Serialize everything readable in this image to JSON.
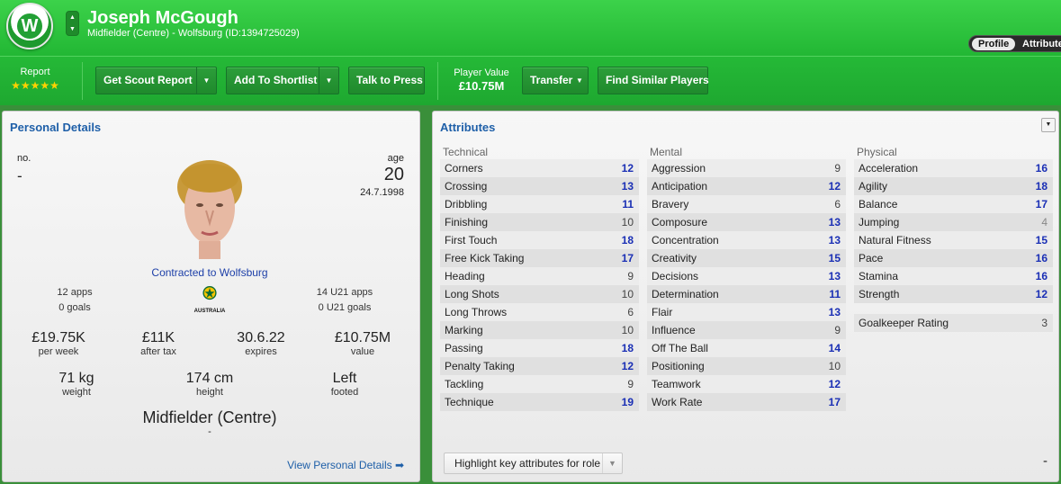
{
  "header": {
    "club_initial": "W",
    "player_name": "Joseph McGough",
    "subtitle": "Midfielder (Centre) - Wolfsburg (ID:1394725029)",
    "tabs": {
      "profile": "Profile",
      "attributes": "Attributes"
    },
    "nav_up": "▲",
    "nav_down": "▼"
  },
  "toolbar": {
    "report_label": "Report",
    "report_stars": "★★★★★",
    "report_rating": 4.5,
    "get_scout_report": "Get Scout Report",
    "add_to_shortlist": "Add To Shortlist",
    "talk_to_press": "Talk to Press",
    "player_value_label": "Player Value",
    "player_value": "£10.75M",
    "transfer": "Transfer",
    "find_similar": "Find Similar Players",
    "dropdown_glyph": "▼"
  },
  "personal": {
    "title": "Personal Details",
    "no_label": "no.",
    "no_value": "-",
    "age_label": "age",
    "age_value": "20",
    "dob": "24.7.1998",
    "contract": "Contracted to Wolfsburg",
    "apps": "12 apps",
    "goals": "0 goals",
    "u21_apps": "14 U21 apps",
    "u21_goals": "0 U21 goals",
    "nation": "AUSTRALIA",
    "wage": "£19.75K",
    "wage_label": "per week",
    "after_tax": "£11K",
    "after_tax_label": "after tax",
    "expires": "30.6.22",
    "expires_label": "expires",
    "value": "£10.75M",
    "value_label": "value",
    "weight": "71 kg",
    "weight_label": "weight",
    "height": "174 cm",
    "height_label": "height",
    "foot": "Left",
    "foot_label": "footed",
    "position": "Midfielder (Centre)",
    "position_sub": "-",
    "view_link": "View Personal Details ➡"
  },
  "attributes": {
    "title": "Attributes",
    "technical_label": "Technical",
    "mental_label": "Mental",
    "physical_label": "Physical",
    "technical": [
      {
        "name": "Corners",
        "value": "12"
      },
      {
        "name": "Crossing",
        "value": "13"
      },
      {
        "name": "Dribbling",
        "value": "11"
      },
      {
        "name": "Finishing",
        "value": "10"
      },
      {
        "name": "First Touch",
        "value": "18"
      },
      {
        "name": "Free Kick Taking",
        "value": "17"
      },
      {
        "name": "Heading",
        "value": "9"
      },
      {
        "name": "Long Shots",
        "value": "10"
      },
      {
        "name": "Long Throws",
        "value": "6"
      },
      {
        "name": "Marking",
        "value": "10"
      },
      {
        "name": "Passing",
        "value": "18"
      },
      {
        "name": "Penalty Taking",
        "value": "12"
      },
      {
        "name": "Tackling",
        "value": "9"
      },
      {
        "name": "Technique",
        "value": "19"
      }
    ],
    "mental": [
      {
        "name": "Aggression",
        "value": "9"
      },
      {
        "name": "Anticipation",
        "value": "12"
      },
      {
        "name": "Bravery",
        "value": "6"
      },
      {
        "name": "Composure",
        "value": "13"
      },
      {
        "name": "Concentration",
        "value": "13"
      },
      {
        "name": "Creativity",
        "value": "15"
      },
      {
        "name": "Decisions",
        "value": "13"
      },
      {
        "name": "Determination",
        "value": "11"
      },
      {
        "name": "Flair",
        "value": "13"
      },
      {
        "name": "Influence",
        "value": "9"
      },
      {
        "name": "Off The Ball",
        "value": "14"
      },
      {
        "name": "Positioning",
        "value": "10"
      },
      {
        "name": "Teamwork",
        "value": "12"
      },
      {
        "name": "Work Rate",
        "value": "17"
      }
    ],
    "physical": [
      {
        "name": "Acceleration",
        "value": "16"
      },
      {
        "name": "Agility",
        "value": "18"
      },
      {
        "name": "Balance",
        "value": "17"
      },
      {
        "name": "Jumping",
        "value": "4"
      },
      {
        "name": "Natural Fitness",
        "value": "15"
      },
      {
        "name": "Pace",
        "value": "16"
      },
      {
        "name": "Stamina",
        "value": "16"
      },
      {
        "name": "Strength",
        "value": "12"
      }
    ],
    "goalkeeper_rating_label": "Goalkeeper Rating",
    "goalkeeper_rating": "3",
    "highlight_label": "Highlight key attributes for role",
    "bottom_right": "-"
  }
}
